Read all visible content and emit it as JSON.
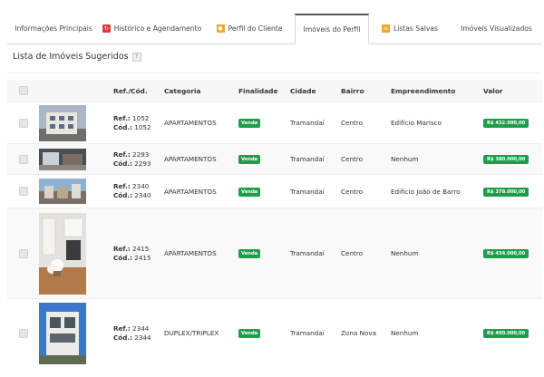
{
  "tabs": [
    {
      "label": "Informações Principais",
      "icon": null,
      "active": false
    },
    {
      "label": "Histórico e Agendamento",
      "icon": "history-icon",
      "icon_color": "#e03b3b",
      "active": false
    },
    {
      "label": "Perfil do Cliente",
      "icon": "user-icon",
      "icon_color": "#f0a52e",
      "active": false
    },
    {
      "label": "Imóveis do Perfil",
      "icon": null,
      "active": true
    },
    {
      "label": "Listas Salvas",
      "icon": "list-icon",
      "icon_color": "#f0a52e",
      "active": false
    },
    {
      "label": "Imóveis Visualizados",
      "icon": null,
      "active": false
    }
  ],
  "section": {
    "title": "Lista de Imóveis Sugeridos",
    "help": "?"
  },
  "table": {
    "headers": {
      "ref": "Ref./Cód.",
      "categoria": "Categoria",
      "finalidade": "Finalidade",
      "cidade": "Cidade",
      "bairro": "Bairro",
      "empreendimento": "Empreendimento",
      "valor": "Valor"
    },
    "ref_label": "Ref.:",
    "cod_label": "Cód.:",
    "rows": [
      {
        "ref": "1052",
        "cod": "1052",
        "categoria": "APARTAMENTOS",
        "finalidade": "Venda",
        "cidade": "Tramandaí",
        "bairro": "Centro",
        "empreendimento": "Edifício Marisco",
        "valor": "R$ 432.000,00"
      },
      {
        "ref": "2293",
        "cod": "2293",
        "categoria": "APARTAMENTOS",
        "finalidade": "Venda",
        "cidade": "Tramandaí",
        "bairro": "Centro",
        "empreendimento": "Nenhum",
        "valor": "R$ 380.000,00"
      },
      {
        "ref": "2340",
        "cod": "2340",
        "categoria": "APARTAMENTOS",
        "finalidade": "Venda",
        "cidade": "Tramandaí",
        "bairro": "Centro",
        "empreendimento": "Edifício João de Barro",
        "valor": "R$ 378.000,00"
      },
      {
        "ref": "2415",
        "cod": "2415",
        "categoria": "APARTAMENTOS",
        "finalidade": "Venda",
        "cidade": "Tramandaí",
        "bairro": "Centro",
        "empreendimento": "Nenhum",
        "valor": "R$ 434.000,00"
      },
      {
        "ref": "2344",
        "cod": "2344",
        "categoria": "DUPLEX/TRIPLEX",
        "finalidade": "Venda",
        "cidade": "Tramandaí",
        "bairro": "Zona Nova",
        "empreendimento": "Nenhum",
        "valor": "R$ 400.000,00"
      }
    ]
  },
  "colors": {
    "accent_green": "#1e9e4a",
    "header_bg": "#f7f7f7"
  }
}
